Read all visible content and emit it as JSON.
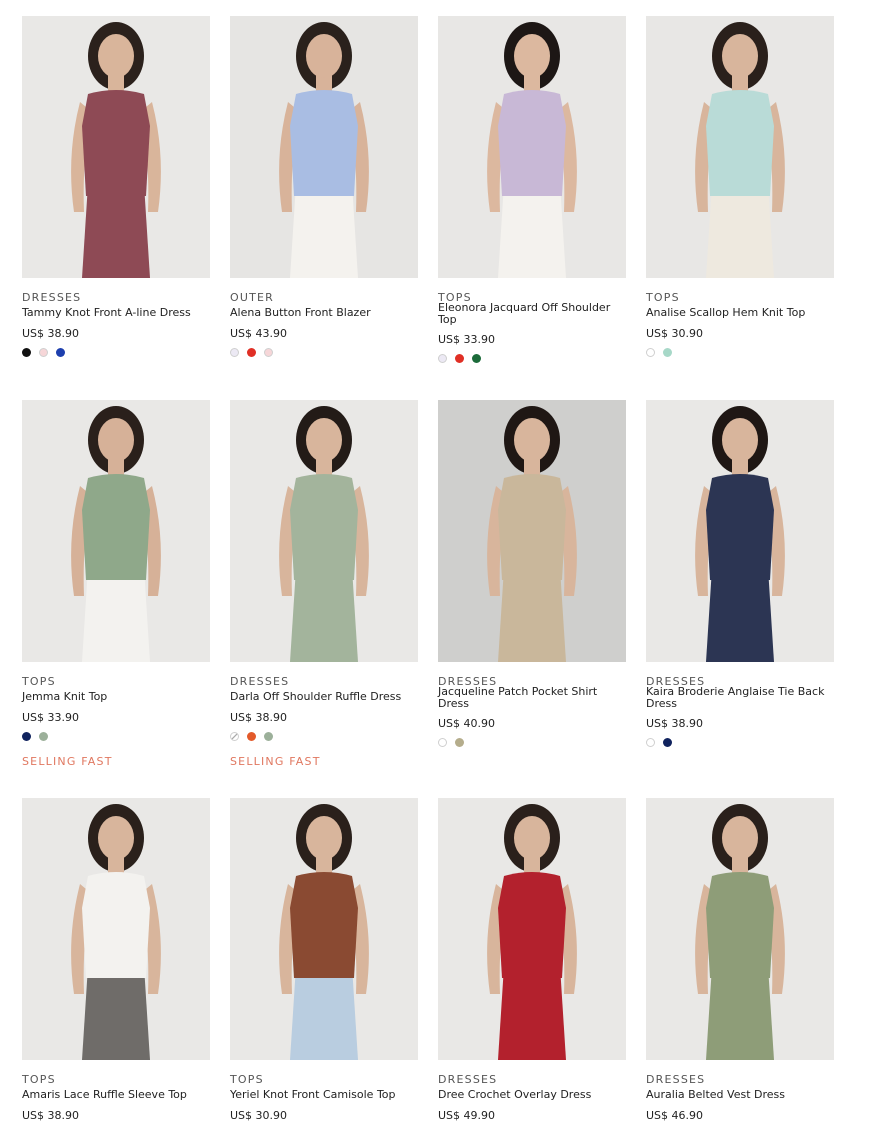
{
  "products": [
    {
      "category": "DRESSES",
      "name": "Tammy Knot Front A-line Dress",
      "price": "US$ 38.90",
      "swatches": [
        "#111111",
        "#f6d6d8",
        "#1d3fae"
      ],
      "bg": "#e9e8e6",
      "garment": "#8e4a55",
      "skin": "#d9b59b",
      "hair": "#2b211c",
      "bottom": "#8e4a55"
    },
    {
      "category": "OUTER",
      "name": "Alena Button Front Blazer",
      "price": "US$ 43.90",
      "swatches": [
        "#ece9f4",
        "#e02f25",
        "#f6d6d8"
      ],
      "bg": "#e6e5e3",
      "garment": "#a9bde3",
      "skin": "#d8b39a",
      "hair": "#2a211c",
      "bottom": "#f4f2ee"
    },
    {
      "category": "TOPS",
      "name": "Eleonora Jacquard Off Shoulder Top",
      "price": "US$ 33.90",
      "swatches": [
        "#ece9f4",
        "#e02f25",
        "#1c6b3a"
      ],
      "bg": "#e8e7e5",
      "garment": "#c8b8d6",
      "skin": "#dcb89f",
      "hair": "#1d1715",
      "bottom": "#f4f2ee"
    },
    {
      "category": "TOPS",
      "name": "Analise Scallop Hem Knit Top",
      "price": "US$ 30.90",
      "swatches": [
        "#ffffff",
        "#a7d8c8"
      ],
      "bg": "#e8e7e5",
      "garment": "#b9dbd7",
      "skin": "#d8b59c",
      "hair": "#2a201b",
      "bottom": "#eee9df"
    },
    {
      "category": "TOPS",
      "name": "Jemma Knit Top",
      "price": "US$ 33.90",
      "swatches": [
        "#10235e",
        "#9cb09a"
      ],
      "selling": "SELLING FAST",
      "bg": "#e9e8e6",
      "garment": "#8fa88a",
      "skin": "#d6b198",
      "hair": "#2a201b",
      "bottom": "#f3f2ef"
    },
    {
      "category": "DRESSES",
      "name": "Darla Off Shoulder Ruffle Dress",
      "price": "US$ 38.90",
      "swatches": [
        "strike",
        "#e35a2a",
        "#9cb09a"
      ],
      "selling": "SELLING FAST",
      "bg": "#e9e8e6",
      "garment": "#a3b49c",
      "skin": "#d8b59c",
      "hair": "#231b17",
      "bottom": "#a3b49c"
    },
    {
      "category": "DRESSES",
      "name": "Jacqueline Patch Pocket Shirt Dress",
      "price": "US$ 40.90",
      "swatches": [
        "#ffffff",
        "#b5ad8c"
      ],
      "bg": "#cfcfcd",
      "garment": "#c9b79b",
      "skin": "#d8b59c",
      "hair": "#1f1714",
      "bottom": "#c9b79b"
    },
    {
      "category": "DRESSES",
      "name": "Kaira Broderie Anglaise Tie Back Dress",
      "price": "US$ 38.90",
      "swatches": [
        "#ffffff",
        "#10235e"
      ],
      "bg": "#e9e8e6",
      "garment": "#2c3553",
      "skin": "#d8b59c",
      "hair": "#1f1714",
      "bottom": "#2c3553"
    },
    {
      "category": "TOPS",
      "name": "Amaris Lace Ruffle Sleeve Top",
      "price": "US$ 38.90",
      "swatches": [],
      "bg": "#e9e8e6",
      "garment": "#f3f2ef",
      "skin": "#d8b59c",
      "hair": "#2a201b",
      "bottom": "#6f6c69"
    },
    {
      "category": "TOPS",
      "name": "Yeriel Knot Front Camisole Top",
      "price": "US$ 30.90",
      "swatches": [],
      "bg": "#e9e8e6",
      "garment": "#8a4a32",
      "skin": "#d8b59c",
      "hair": "#2a201b",
      "bottom": "#b9cde0"
    },
    {
      "category": "DRESSES",
      "name": "Dree Crochet Overlay Dress",
      "price": "US$ 49.90",
      "swatches": [],
      "bg": "#e9e8e6",
      "garment": "#b3212d",
      "skin": "#d8b59c",
      "hair": "#2a201b",
      "bottom": "#b3212d"
    },
    {
      "category": "DRESSES",
      "name": "Auralia Belted Vest Dress",
      "price": "US$ 46.90",
      "swatches": [],
      "bg": "#e9e8e6",
      "garment": "#8e9d78",
      "skin": "#d8b59c",
      "hair": "#2a201b",
      "bottom": "#8e9d78"
    }
  ]
}
